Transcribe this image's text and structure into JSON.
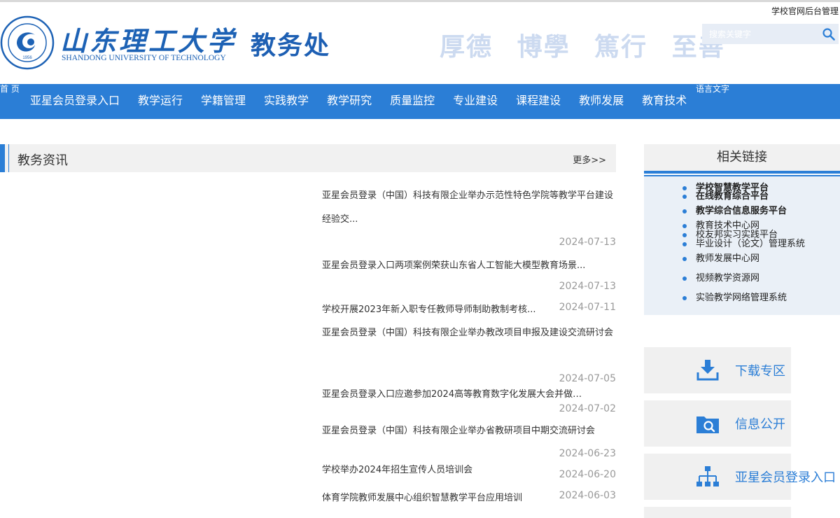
{
  "header": {
    "admin_link": "学校官网后台管理",
    "university_name_cn": "山东理工大学",
    "university_name_en": "SHANDONG UNIVERSITY OF TECHNOLOGY",
    "emblem_year": "1956",
    "department": "教务处",
    "motto": [
      "厚德",
      "博學",
      "篤行",
      "至善"
    ],
    "search_placeholder": "搜索关键字"
  },
  "nav": {
    "home": "首 页",
    "language": "语言文字",
    "items": [
      "亚星会员登录入口",
      "教学运行",
      "学籍管理",
      "实践教学",
      "教学研究",
      "质量监控",
      "专业建设",
      "课程建设",
      "教师发展",
      "教育技术"
    ]
  },
  "news": {
    "title": "教务资讯",
    "more": "更多>>",
    "items": [
      {
        "title": "亚星会员登录（中国）科技有限企业举办示范性特色学院等教学平台建设经验交...",
        "date": "2024-07-13"
      },
      {
        "title": "亚星会员登录入口两项案例荣获山东省人工智能大模型教育场景...",
        "date": "2024-07-13"
      },
      {
        "title": "学校开展2023年新入职专任教师导师制助教制考核...",
        "date": "2024-07-11"
      },
      {
        "title": "亚星会员登录（中国）科技有限企业举办教改项目申报及建设交流研讨会",
        "date": "2024-07-05"
      },
      {
        "title": "亚星会员登录入口应邀参加2024高等教育数字化发展大会并做经...",
        "date": "2024-07-02"
      },
      {
        "title": "亚星会员登录（中国）科技有限企业举办省教研项目中期交流研讨会",
        "date": "2024-06-23"
      },
      {
        "title": "学校举办2024年招生宣传人员培训会",
        "date": "2024-06-20"
      },
      {
        "title": "体育学院教师发展中心组织智慧教学平台应用培训",
        "date": "2024-06-03"
      }
    ]
  },
  "related_links": {
    "title": "相关链接",
    "items": [
      "学校智慧教学平台",
      "在线教育综合平台",
      "教学综合信息服务平台",
      "教育技术中心网",
      "校友邦实习实践平台",
      "毕业设计（论文）管理系统",
      "教师发展中心网",
      "视频教学资源网",
      "实验教学网络管理系统"
    ]
  },
  "side_buttons": {
    "download": "下载专区",
    "info": "信息公开",
    "portal": "亚星会员登录入口"
  },
  "colors": {
    "brand_blue": "#2b7ed6",
    "logo_blue": "#1d62b5",
    "motto_light": "#ccdaf0"
  }
}
